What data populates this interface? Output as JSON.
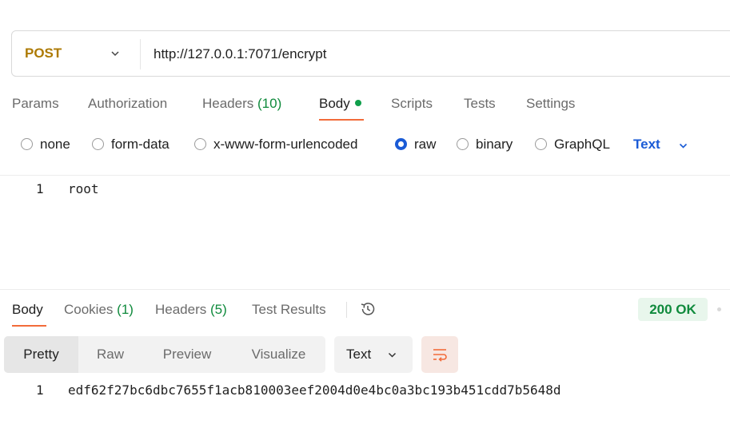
{
  "request": {
    "method": "POST",
    "url": "http://127.0.0.1:7071/encrypt"
  },
  "request_tabs": {
    "params": "Params",
    "authorization": "Authorization",
    "headers_label": "Headers",
    "headers_count": "(10)",
    "body": "Body",
    "scripts": "Scripts",
    "tests": "Tests",
    "settings": "Settings"
  },
  "body_types": {
    "none": "none",
    "form_data": "form-data",
    "urlencoded": "x-www-form-urlencoded",
    "raw": "raw",
    "binary": "binary",
    "graphql": "GraphQL",
    "selected": "raw",
    "format": "Text"
  },
  "editor": {
    "line_number": "1",
    "content": "root"
  },
  "response_tabs": {
    "body": "Body",
    "cookies_label": "Cookies",
    "cookies_count": "(1)",
    "headers_label": "Headers",
    "headers_count": "(5)",
    "test_results": "Test Results"
  },
  "status": "200 OK",
  "view_modes": {
    "pretty": "Pretty",
    "raw": "Raw",
    "preview": "Preview",
    "visualize": "Visualize",
    "format": "Text"
  },
  "response": {
    "line_number": "1",
    "content": "edf62f27bc6dbc7655f1acb810003eef2004d0e4bc0a3bc193b451cdd7b5648d"
  },
  "colors": {
    "method": "#ad7a03",
    "accent": "#f26b3a",
    "link_blue": "#1a5bd6",
    "success": "#0f8a3c"
  }
}
